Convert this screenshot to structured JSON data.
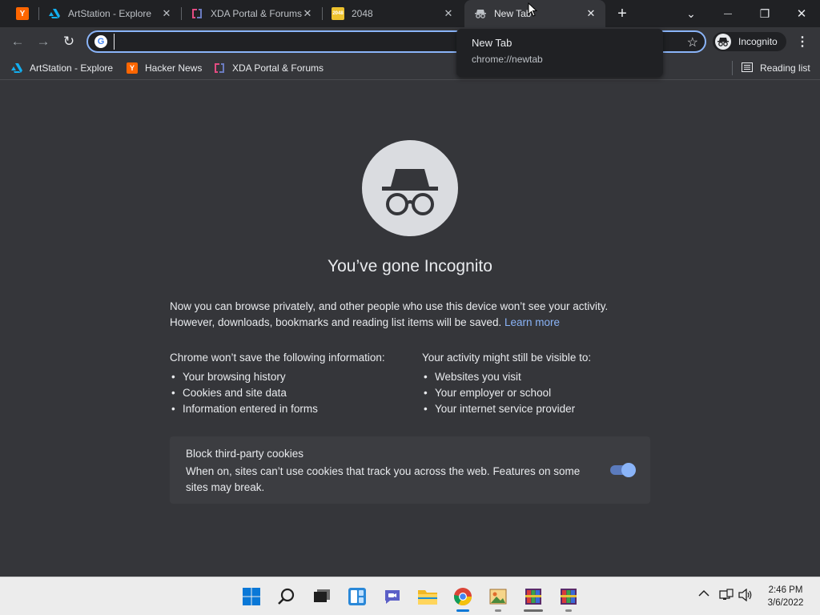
{
  "tabs": [
    {
      "title": "",
      "favicon": "hacker-news",
      "color": "#ff6600",
      "glyph": "Y"
    },
    {
      "title": "ArtStation - Explore",
      "favicon": "artstation",
      "color": "#13aff0"
    },
    {
      "title": "XDA Portal & Forums",
      "favicon": "xda",
      "color": "#e34c81"
    },
    {
      "title": "2048",
      "favicon": "2048",
      "color": "#edc22e",
      "glyph": "2048"
    },
    {
      "title": "New Tab",
      "favicon": "incognito",
      "active": true
    }
  ],
  "tab_close_glyph": "✕",
  "new_tab_glyph": "+",
  "window_controls": {
    "tab_search": "⌄",
    "minimize": "—",
    "restore": "❐",
    "close": "✕"
  },
  "toolbar": {
    "back": "←",
    "forward": "→",
    "reload": "↻",
    "omnibox_value": "",
    "star": "☆",
    "incognito_label": "Incognito",
    "menu": "⋮"
  },
  "bookmarks": [
    {
      "title": "ArtStation - Explore",
      "favicon": "artstation",
      "color": "#13aff0"
    },
    {
      "title": "Hacker News",
      "favicon": "hacker-news",
      "color": "#ff6600",
      "glyph": "Y"
    },
    {
      "title": "XDA Portal & Forums",
      "favicon": "xda",
      "color": "#e34c81"
    }
  ],
  "reading_list": "Reading list",
  "tooltip": {
    "title": "New Tab",
    "url": "chrome://newtab"
  },
  "page": {
    "heading": "You’ve gone Incognito",
    "intro": "Now you can browse privately, and other people who use this device won’t see your activity. However, downloads, bookmarks and reading list items will be saved.",
    "learn_more": "Learn more",
    "left_heading": "Chrome won’t save the following information:",
    "left_items": [
      "Your browsing history",
      "Cookies and site data",
      "Information entered in forms"
    ],
    "right_heading": "Your activity might still be visible to:",
    "right_items": [
      "Websites you visit",
      "Your employer or school",
      "Your internet service provider"
    ],
    "cookie_title": "Block third-party cookies",
    "cookie_desc": "When on, sites can’t use cookies that track you across the web. Features on some sites may break.",
    "cookie_toggle_on": true
  },
  "taskbar": {
    "time": "2:46 PM",
    "date": "3/6/2022",
    "tray_chevron": "^",
    "apps": [
      "start",
      "search",
      "task-view",
      "widgets",
      "teams-chat",
      "file-explorer",
      "chrome",
      "photos",
      "winrar",
      "winrar"
    ]
  },
  "colors": {
    "accent": "#8ab4f8",
    "background": "#35363a",
    "tabstrip": "#202124"
  }
}
